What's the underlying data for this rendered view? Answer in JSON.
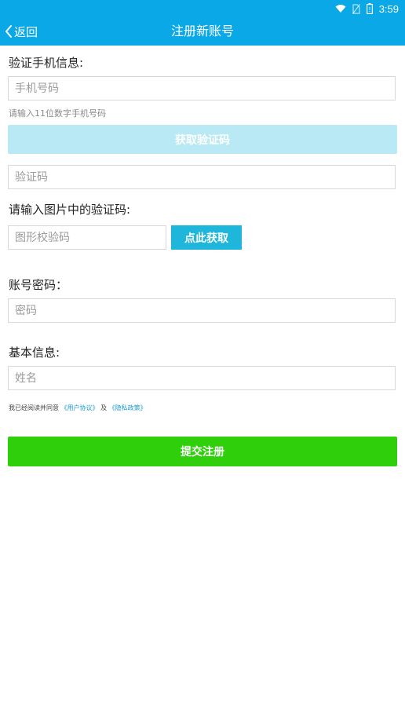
{
  "status_bar": {
    "time": "3:59",
    "icons": [
      "wifi-icon",
      "no-sim-icon",
      "battery-icon"
    ]
  },
  "app_bar": {
    "back_label": "返回",
    "title": "注册新账号"
  },
  "phone_section": {
    "label": "验证手机信息:",
    "phone_placeholder": "手机号码",
    "hint": "请输入11位数字手机号码",
    "get_code_button": "获取验证码",
    "code_placeholder": "验证码"
  },
  "image_code_section": {
    "label": "请输入图片中的验证码:",
    "placeholder": "图形校验码",
    "button": "点此获取"
  },
  "password_section": {
    "label": "账号密码：",
    "placeholder": "密码"
  },
  "basic_section": {
    "label": "基本信息:",
    "name_placeholder": "姓名"
  },
  "agreement": {
    "prefix": "我已经阅读并同意",
    "user_agreement": "《用户协议》",
    "and": "及",
    "privacy_policy": "《隐私政策》"
  },
  "submit_button": "提交注册",
  "colors": {
    "primary": "#0aa8e6",
    "code_button": "#b9e9f5",
    "image_button": "#1fb6dc",
    "submit": "#2fcf0c",
    "link": "#1a9ad6"
  }
}
